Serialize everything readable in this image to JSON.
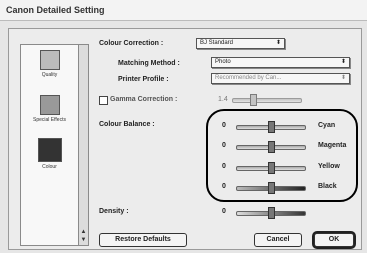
{
  "window": {
    "title": "Canon Detailed Setting"
  },
  "sidebar": {
    "items": [
      {
        "label": "Quality",
        "icon": "quality-icon"
      },
      {
        "label": "Special Effects",
        "icon": "special-effects-icon"
      },
      {
        "label": "Colour",
        "icon": "colour-icon"
      }
    ]
  },
  "colour_correction": {
    "label": "Colour Correction :",
    "value": "BJ Standard"
  },
  "matching_method": {
    "label": "Matching Method :",
    "value": "Photo"
  },
  "printer_profile": {
    "label": "Printer Profile :",
    "value": "Recommended by Can..."
  },
  "gamma": {
    "label": "Gamma Correction :",
    "value": "1.4",
    "checked": false
  },
  "colour_balance": {
    "label": "Colour Balance :",
    "channels": [
      {
        "name": "Cyan",
        "value": "0",
        "level": 0
      },
      {
        "name": "Magenta",
        "value": "0",
        "level": 0
      },
      {
        "name": "Yellow",
        "value": "0",
        "level": 0
      },
      {
        "name": "Black",
        "value": "0",
        "level": 0
      }
    ]
  },
  "density": {
    "label": "Density :",
    "value": "0",
    "level": 0
  },
  "buttons": {
    "restore": "Restore Defaults",
    "cancel": "Cancel",
    "ok": "OK"
  }
}
